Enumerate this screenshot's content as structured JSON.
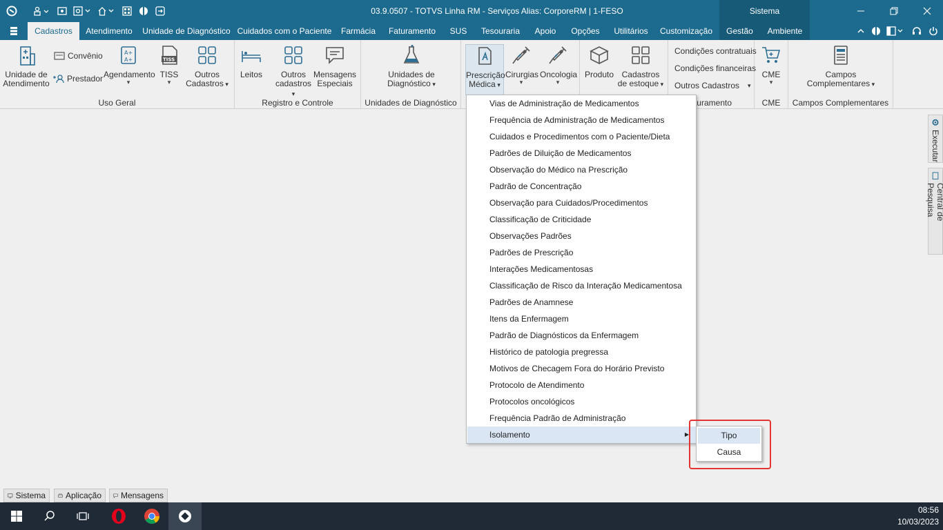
{
  "titlebar": {
    "title": "03.9.0507 - TOTVS Linha RM - Serviços  Alias: CorporeRM | 1-FESO",
    "context_tab": "Sistema",
    "icons": [
      "totvs-logo-icon",
      "users-icon",
      "settings-icon",
      "home-icon",
      "grid-icon",
      "help-icon",
      "exit-icon"
    ]
  },
  "menubar": {
    "tabs": [
      "Cadastros",
      "Atendimento",
      "Unidade de Diagnóstico",
      "Cuidados com o Paciente",
      "Farmácia",
      "Faturamento",
      "SUS",
      "Tesouraria",
      "Apoio",
      "Opções",
      "Utilitários",
      "Customização",
      "Gestão",
      "Ambiente"
    ],
    "active_tab": "Cadastros"
  },
  "ribbon": {
    "uso_geral": {
      "label": "Uso Geral",
      "unidade_atendimento": "Unidade de\nAtendimento",
      "convenio": "Convênio",
      "prestador": "Prestador",
      "agendamento": "Agendamento",
      "tiss": "TISS",
      "outros_cadastros": "Outros\nCadastros"
    },
    "registro_controle": {
      "label": "Registro e Controle",
      "leitos": "Leitos",
      "outros_cadastros": "Outros\ncadastros",
      "mensagens_especiais": "Mensagens\nEspeciais"
    },
    "unidades_diagnostico": {
      "label": "Unidades de Diagnóstico",
      "button": "Unidades de\nDiagnóstico"
    },
    "prescricao": {
      "prescricao_medica": "Prescrição\nMédica",
      "cirurgias": "Cirurgias",
      "oncologia": "Oncologia"
    },
    "estoque": {
      "produto": "Produto",
      "cadastros_estoque": "Cadastros\nde estoque"
    },
    "faturamento": {
      "label": "aturamento",
      "condicoes_contratuais": "Condições contratuais",
      "condicoes_financeiras": "Condições financeiras",
      "outros_cadastros": "Outros Cadastros"
    },
    "cme": {
      "label": "CME",
      "button": "CME"
    },
    "campos_complementares": {
      "label": "Campos Complementares",
      "button": "Campos\nComplementares"
    }
  },
  "dropdown": {
    "items": [
      "Vias de Administração de Medicamentos",
      "Frequência de Administração de Medicamentos",
      "Cuidados e Procedimentos com o Paciente/Dieta",
      "Padrões de Diluição de Medicamentos",
      "Observação do Médico na Prescrição",
      "Padrão de Concentração",
      "Observação para Cuidados/Procedimentos",
      "Classificação de Criticidade",
      "Observações Padrões",
      "Padrões de Prescrição",
      "Interações Medicamentosas",
      "Classificação de Risco da Interação Medicamentosa",
      "Padrões de Anamnese",
      "Itens da Enfermagem",
      "Padrão de Diagnósticos da Enfermagem",
      "Histórico de patologia pregressa",
      "Motivos de Checagem Fora do Horário Previsto",
      "Protocolo de Atendimento",
      "Protocolos oncológicos",
      "Frequência Padrão de Administração",
      "Isolamento"
    ],
    "highlighted": "Isolamento"
  },
  "submenu": {
    "items": [
      "Tipo",
      "Causa"
    ],
    "highlighted": "Tipo"
  },
  "side_panel": {
    "executar": "Executar",
    "central_pesquisa": "Central de Pesquisa"
  },
  "bottom_tabs": [
    "Sistema",
    "Aplicação",
    "Mensagens"
  ],
  "taskbar": {
    "time": "08:56",
    "date": "10/03/2023",
    "apps": [
      "windows-start-icon",
      "search-icon",
      "task-view-icon",
      "opera-icon",
      "chrome-icon",
      "totvs-app-icon"
    ]
  },
  "colors": {
    "title_blue": "#1c6a8d",
    "highlight": "#dbe6f4",
    "red_box": "#e3342f"
  }
}
